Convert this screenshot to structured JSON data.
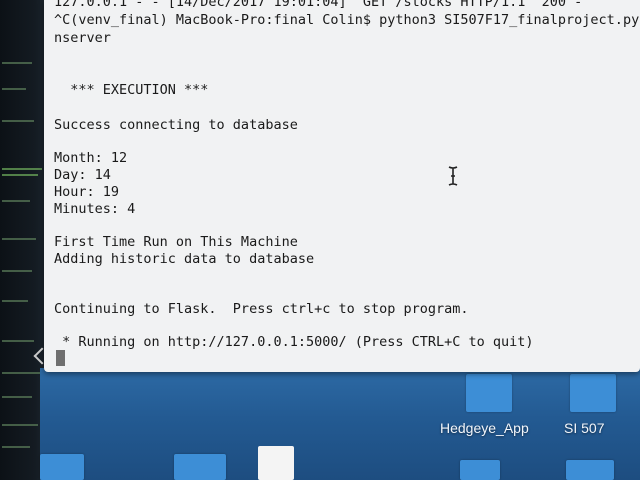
{
  "terminal": {
    "lines": [
      "127.0.0.1 - - [14/Dec/2017 19:01:04] \"GET /stocks HTTP/1.1\" 200 -",
      "^C(venv_final) MacBook-Pro:final Colin$ python3 SI507F17_finalproject.py",
      "nserver",
      "",
      "",
      "  *** EXECUTION ***",
      "",
      "Success connecting to database",
      "",
      "Month: 12",
      "Day: 14",
      "Hour: 19",
      "Minutes: 4",
      "",
      "First Time Run on This Machine",
      "Adding historic data to database",
      "",
      "",
      "Continuing to Flask.  Press ctrl+c to stop program.",
      "",
      " * Running on http://127.0.0.1:5000/ (Press CTRL+C to quit)"
    ]
  },
  "desktop": {
    "icons": [
      {
        "label": "Hedgeye_App"
      },
      {
        "label": "SI 507"
      }
    ]
  },
  "icons": {
    "text_cursor": "ibeam-cursor-icon",
    "terminal_cursor": "block-cursor-icon",
    "scroll_arrow": "chevron-left-icon"
  }
}
